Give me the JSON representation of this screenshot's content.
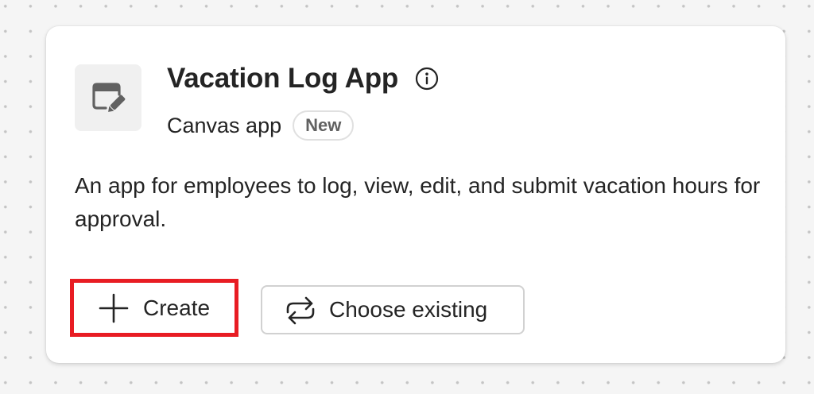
{
  "card": {
    "icon": "canvas-app-edit-icon",
    "title": "Vacation Log App",
    "info_icon": "info-icon",
    "subtitle": "Canvas app",
    "badge": "New",
    "description": "An app for employees to log, view, edit, and submit vacation hours for approval.",
    "actions": {
      "create_label": "Create",
      "create_icon": "plus-icon",
      "choose_label": "Choose existing",
      "choose_icon": "swap-arrows-icon"
    }
  },
  "colors": {
    "background": "#f5f5f5",
    "card": "#ffffff",
    "text": "#242424",
    "badge_text": "#616161",
    "highlight": "#e81c23"
  }
}
